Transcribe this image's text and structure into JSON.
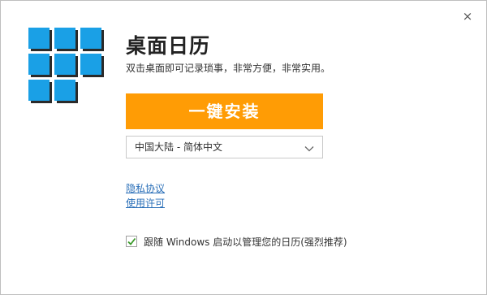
{
  "window": {
    "close_glyph": "×"
  },
  "app": {
    "title": "桌面日历",
    "subtitle": "双击桌面即可记录琐事，非常方便，非常实用。"
  },
  "install": {
    "button_label": "一键安装",
    "button_color": "#ff9c05"
  },
  "language": {
    "selected": "中国大陆 - 简体中文"
  },
  "links": {
    "privacy": "隐私协议",
    "license": "使用许可"
  },
  "autostart": {
    "checked": true,
    "label": "跟随 Windows 启动以管理您的日历(强烈推荐)"
  },
  "colors": {
    "logo_tile": "#1aa0e6",
    "link": "#2a6fb8",
    "check": "#3a9a2a"
  }
}
